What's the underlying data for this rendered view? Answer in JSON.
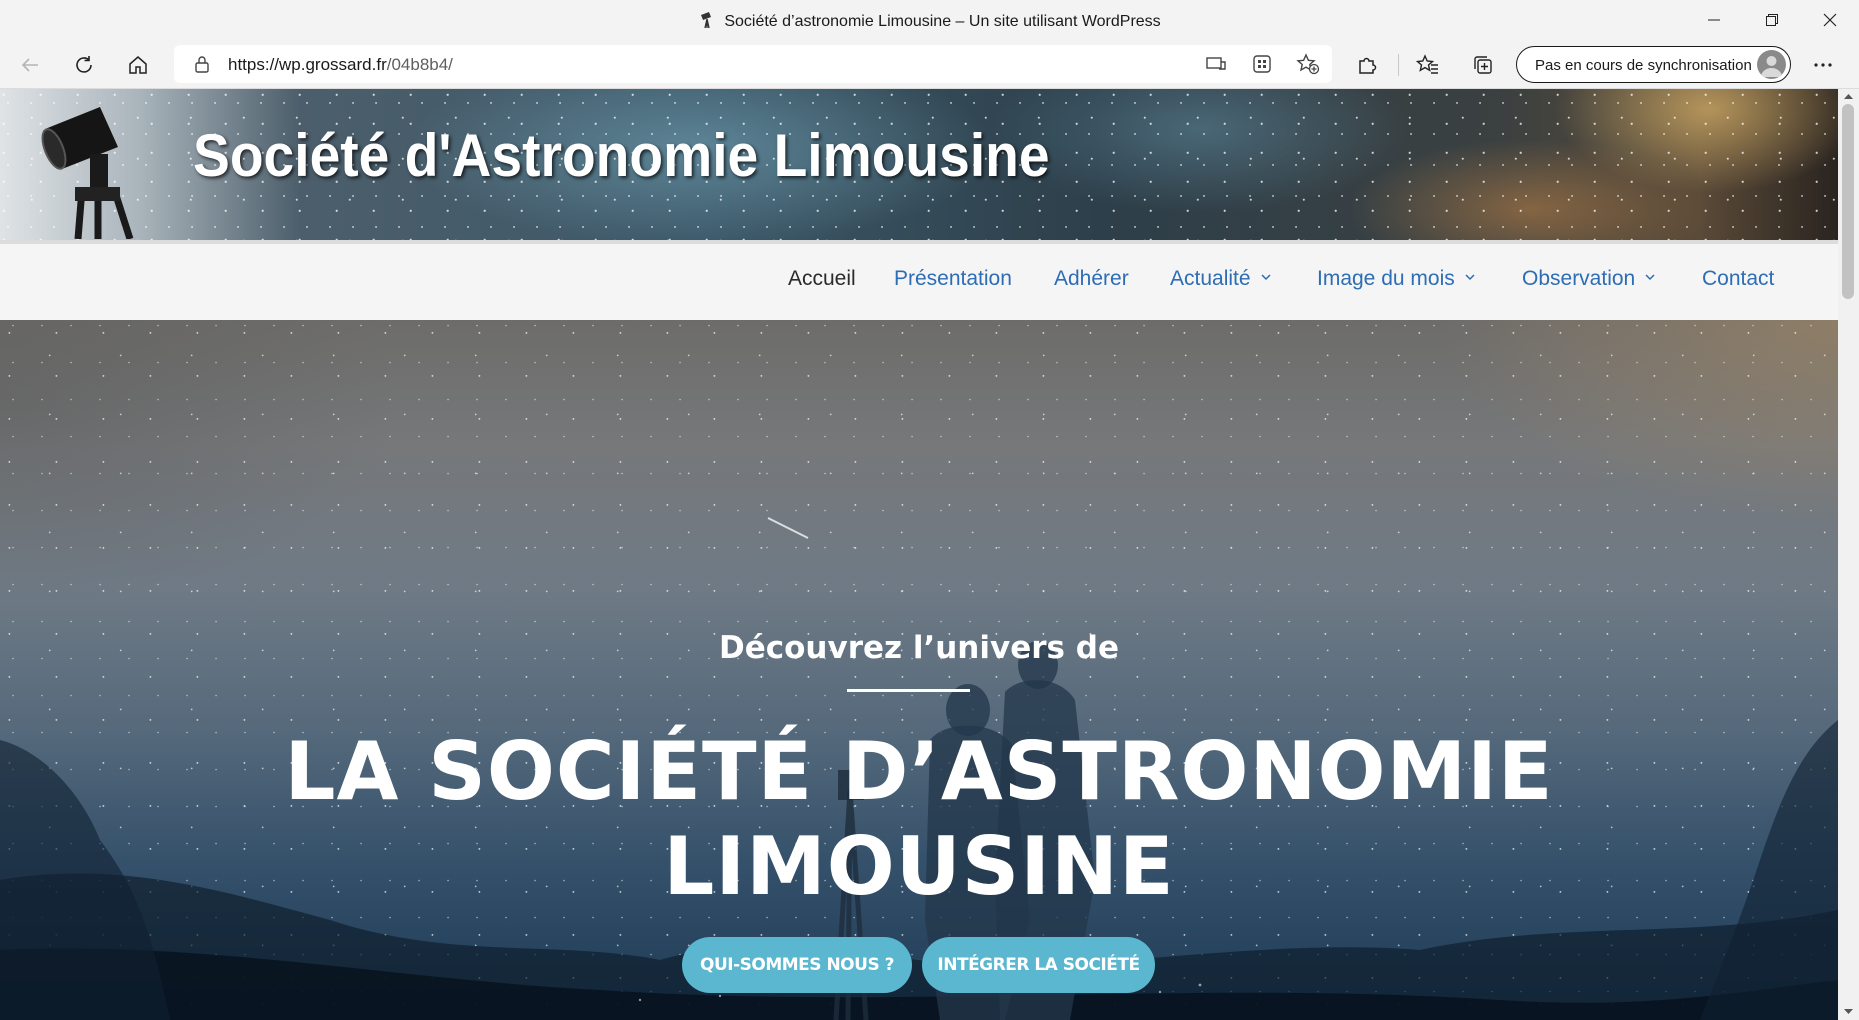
{
  "window": {
    "title": "Société d’astronomie Limousine – Un site utilisant WordPress"
  },
  "toolbar": {
    "url_host": "https://wp.grossard.fr",
    "url_path": "/04b8b4/",
    "sync_label": "Pas en cours de synchronisation"
  },
  "banner": {
    "title": "Société d'Astronomie Limousine"
  },
  "nav": {
    "items": [
      {
        "label": "Accueil",
        "active": true,
        "dropdown": false
      },
      {
        "label": "Présentation",
        "active": false,
        "dropdown": false
      },
      {
        "label": "Adhérer",
        "active": false,
        "dropdown": false
      },
      {
        "label": "Actualité",
        "active": false,
        "dropdown": true
      },
      {
        "label": "Image du mois",
        "active": false,
        "dropdown": true
      },
      {
        "label": "Observation",
        "active": false,
        "dropdown": true
      },
      {
        "label": "Contact",
        "active": false,
        "dropdown": false
      }
    ]
  },
  "hero": {
    "kicker": "Découvrez l’univers de",
    "headline_line1": "LA SOCIÉTÉ D’ASTRONOMIE",
    "headline_line2": "LIMOUSINE",
    "buttons": [
      {
        "label": "QUI-SOMMES NOUS ?"
      },
      {
        "label": "INTÉGRER LA SOCIÉTÉ"
      }
    ]
  },
  "colors": {
    "nav_link": "#2d6db5",
    "nav_active": "#2b2b2b",
    "cta": "#5bb6cf",
    "browser_chrome": "#f3f3f3"
  },
  "icons": [
    "back-arrow-icon",
    "refresh-icon",
    "home-icon",
    "lock-icon",
    "read-aloud-icon",
    "apps-icon",
    "add-favorite-icon",
    "extensions-icon",
    "favorites-icon",
    "collections-icon",
    "more-icon",
    "minimize-icon",
    "restore-icon",
    "close-icon",
    "telescope-icon",
    "chevron-down-icon"
  ]
}
